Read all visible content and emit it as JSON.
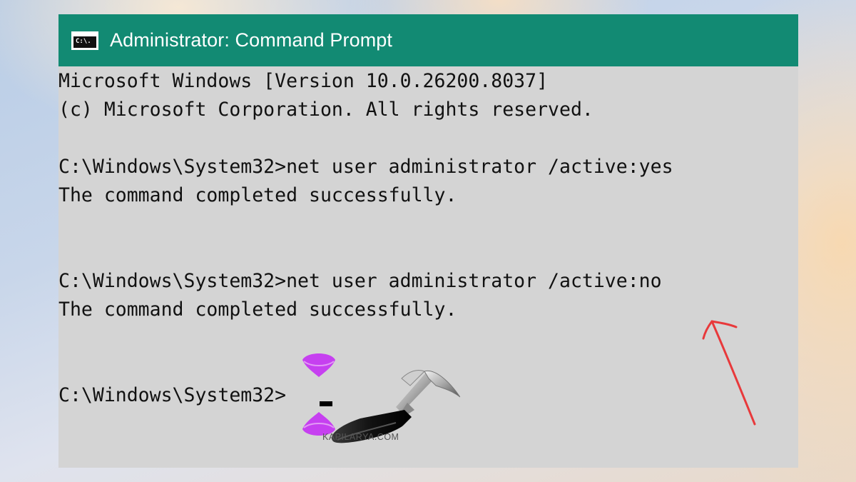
{
  "window": {
    "title": "Administrator: Command Prompt",
    "icon": "cmd-icon",
    "icon_text": "C:\\."
  },
  "console": {
    "lines": [
      "Microsoft Windows [Version 10.0.26200.8037]",
      "(c) Microsoft Corporation. All rights reserved.",
      "",
      "C:\\Windows\\System32>net user administrator /active:yes",
      "The command completed successfully.",
      "",
      "",
      "C:\\Windows\\System32>net user administrator /active:no",
      "The command completed successfully.",
      "",
      "",
      "C:\\Windows\\System32>"
    ]
  },
  "overlay": {
    "watermark_text": "KAPILARYA.COM",
    "watermark_icon": "hammer-icon",
    "annotation": "red-arrow-icon",
    "accent_color": "#128a73",
    "cursor_marker_color": "#c640f0",
    "arrow_color": "#e8393b"
  }
}
